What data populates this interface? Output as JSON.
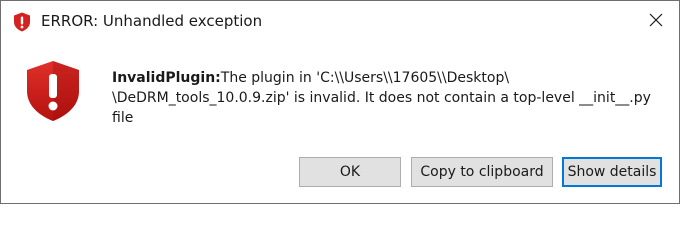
{
  "window": {
    "title": "ERROR: Unhandled exception",
    "close_glyph": "✕"
  },
  "icons": {
    "title_icon": "error-shield-icon",
    "main_icon": "error-shield-icon",
    "close_icon": "close-icon",
    "error_color": "#d3221f"
  },
  "message": {
    "label": "InvalidPlugin:",
    "text": "The plugin in 'C:\\\\Users\\\\17605\\\\Desktop\\ \\DeDRM_tools_10.0.9.zip' is invalid. It does not contain a top-level __init__.py file"
  },
  "buttons": {
    "ok": "OK",
    "copy": "Copy to clipboard",
    "details": "Show details"
  }
}
